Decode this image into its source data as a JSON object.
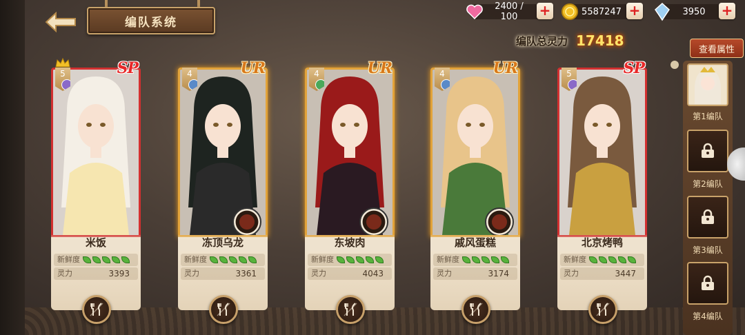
{
  "header": {
    "title": "编队系统",
    "resources": [
      {
        "icon": "heart-icon",
        "value": "2400 / 100",
        "color": "#f06aa0"
      },
      {
        "icon": "gold-coin-icon",
        "value": "5587247",
        "color": "#f2c027"
      },
      {
        "icon": "crystal-icon",
        "value": "3950",
        "color": "#9fd0f2"
      }
    ],
    "total_power_label": "编队总灵力",
    "total_power_value": "17418",
    "view_attr_label": "查看属性"
  },
  "cards": [
    {
      "name": "米饭",
      "rarity": "SP",
      "level": "5",
      "freshness_label": "新鲜度",
      "power_label": "灵力",
      "power": "3393",
      "freshness": 5,
      "element_color": "#8a6ac8",
      "hair": "#f4efe6",
      "outfit": "#f6e6b0",
      "stars": ""
    },
    {
      "name": "冻顶乌龙",
      "rarity": "UR",
      "level": "4",
      "freshness_label": "新鲜度",
      "power_label": "灵力",
      "power": "3361",
      "freshness": 5,
      "element_color": "#5a8ac8",
      "hair": "#1e2420",
      "outfit": "#2a2a2a",
      "stars": ""
    },
    {
      "name": "东坡肉",
      "rarity": "UR",
      "level": "4",
      "freshness_label": "新鲜度",
      "power_label": "灵力",
      "power": "4043",
      "freshness": 5,
      "element_color": "#4aa85a",
      "hair": "#9a1a1a",
      "outfit": "#2a1a22",
      "stars": "★★"
    },
    {
      "name": "戚风蛋糕",
      "rarity": "UR",
      "level": "4",
      "freshness_label": "新鲜度",
      "power_label": "灵力",
      "power": "3174",
      "freshness": 5,
      "element_color": "#5a8ac8",
      "hair": "#e8c48a",
      "outfit": "#4a7a3a",
      "stars": ""
    },
    {
      "name": "北京烤鸭",
      "rarity": "SP",
      "level": "5",
      "freshness_label": "新鲜度",
      "power_label": "灵力",
      "power": "3447",
      "freshness": 5,
      "element_color": "#8a6ac8",
      "hair": "#7a5a3e",
      "outfit": "#c9a040",
      "stars": ""
    }
  ],
  "sidebar": {
    "teams": [
      {
        "label": "第1编队",
        "state": "active"
      },
      {
        "label": "第2编队",
        "state": "locked"
      },
      {
        "label": "第3编队",
        "state": "locked"
      },
      {
        "label": "第4编队",
        "state": "locked"
      }
    ]
  }
}
